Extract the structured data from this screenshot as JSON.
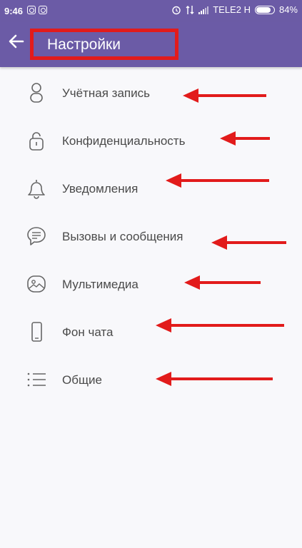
{
  "status_bar": {
    "time": "9:46",
    "carrier": "TELE2 H",
    "battery": "84%",
    "battery_level": 0.84,
    "icons": [
      "app-notification-icon",
      "app-notification-icon",
      "alarm-icon",
      "data-arrows-icon",
      "signal-icon",
      "battery-icon"
    ]
  },
  "app_bar": {
    "title": "Настройки",
    "back_icon": "arrow-left-icon",
    "background_color": "#6b5ba6"
  },
  "menu": {
    "items": [
      {
        "label": "Учётная запись",
        "icon": "account-icon"
      },
      {
        "label": "Конфиденциальность",
        "icon": "lock-icon"
      },
      {
        "label": "Уведомления",
        "icon": "bell-icon"
      },
      {
        "label": "Вызовы и сообщения",
        "icon": "chat-bubble-icon"
      },
      {
        "label": "Мультимедиа",
        "icon": "media-icon"
      },
      {
        "label": "Фон чата",
        "icon": "phone-icon"
      },
      {
        "label": "Общие",
        "icon": "list-icon"
      }
    ]
  },
  "annotations": {
    "highlight_color": "#e21b1b",
    "arrow_color": "#e21b1b"
  }
}
